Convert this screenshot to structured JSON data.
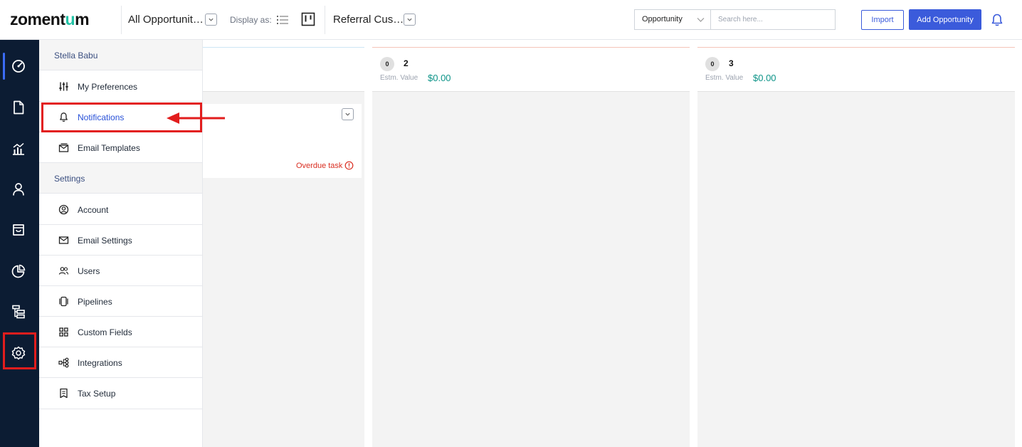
{
  "brand": {
    "logo_text_a": "zoment",
    "logo_text_b": "u",
    "logo_text_c": "m"
  },
  "header": {
    "view_name": "All Opportunit…",
    "display_as_label": "Display as:",
    "pipeline_name": "Referral Cus…",
    "type_select_value": "Opportunity",
    "search_placeholder": "Search here...",
    "import_label": "Import",
    "add_label": "Add Opportunity"
  },
  "sidebar": {
    "items": [
      {
        "name": "dashboard-icon"
      },
      {
        "name": "document-icon"
      },
      {
        "name": "reports-icon"
      },
      {
        "name": "contacts-icon"
      },
      {
        "name": "inbox-icon"
      },
      {
        "name": "analytics-icon"
      },
      {
        "name": "hierarchy-icon"
      },
      {
        "name": "settings-icon"
      }
    ]
  },
  "menu": {
    "user_name": "Stella Babu",
    "settings_heading": "Settings",
    "user_items": [
      {
        "label": "My Preferences",
        "icon": "sliders-icon"
      },
      {
        "label": "Notifications",
        "icon": "bell-icon",
        "active": true
      },
      {
        "label": "Email Templates",
        "icon": "email-template-icon"
      }
    ],
    "settings_items": [
      {
        "label": "Account",
        "icon": "account-icon"
      },
      {
        "label": "Email Settings",
        "icon": "mail-icon"
      },
      {
        "label": "Users",
        "icon": "users-icon"
      },
      {
        "label": "Pipelines",
        "icon": "pipelines-icon"
      },
      {
        "label": "Custom Fields",
        "icon": "grid-icon"
      },
      {
        "label": "Integrations",
        "icon": "integrations-icon"
      },
      {
        "label": "Tax Setup",
        "icon": "tax-icon"
      }
    ]
  },
  "board": {
    "columns": [
      {
        "count": "0",
        "name": "2",
        "estm_label": "Estm. Value",
        "estm_value": "$0.00"
      },
      {
        "count": "0",
        "name": "3",
        "estm_label": "Estm. Value",
        "estm_value": "$0.00"
      }
    ],
    "card": {
      "status_text": "Overdue task"
    }
  },
  "colors": {
    "accent": "#3b5bdb",
    "sidebar_bg": "#0c1c33",
    "highlight": "#e21d1d",
    "value": "#0d9488"
  }
}
